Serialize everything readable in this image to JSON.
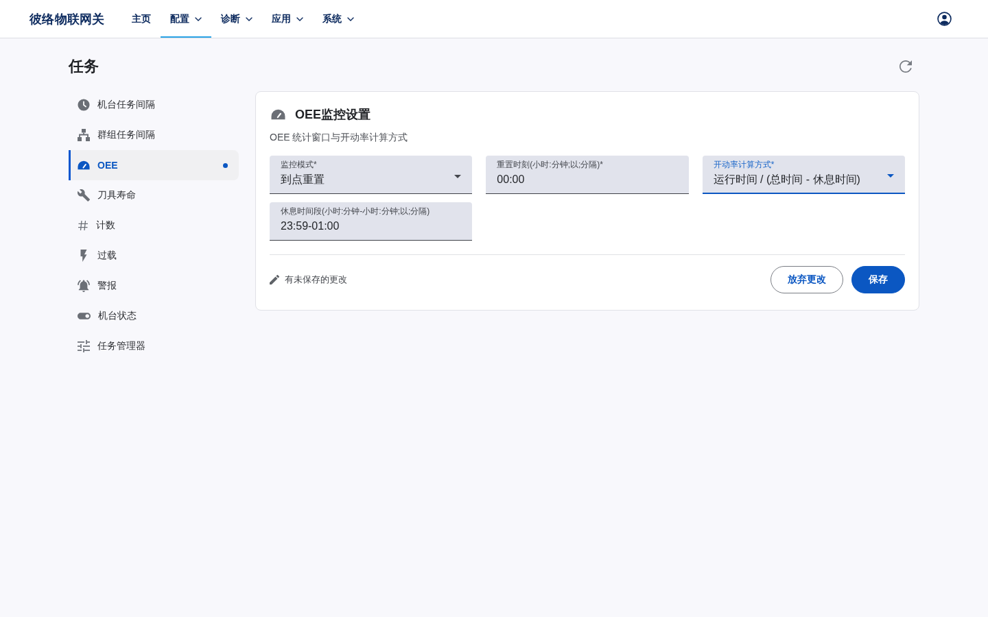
{
  "app_bar": {
    "brand": "彼络物联网关",
    "nav": [
      {
        "label": "主页",
        "selected": false,
        "has_menu": false
      },
      {
        "label": "配置",
        "selected": true,
        "has_menu": true
      },
      {
        "label": "诊断",
        "selected": false,
        "has_menu": true
      },
      {
        "label": "应用",
        "selected": false,
        "has_menu": true
      },
      {
        "label": "系统",
        "selected": false,
        "has_menu": true
      }
    ]
  },
  "page_title": "任务",
  "sidebar": {
    "items": [
      {
        "label": "机台任务间隔",
        "selected": false,
        "unsaved": false
      },
      {
        "label": "群组任务间隔",
        "selected": false,
        "unsaved": false
      },
      {
        "label": "OEE",
        "selected": true,
        "unsaved": true
      },
      {
        "label": "刀具寿命",
        "selected": false,
        "unsaved": false
      },
      {
        "label": "计数",
        "selected": false,
        "unsaved": false
      },
      {
        "label": "过载",
        "selected": false,
        "unsaved": false
      },
      {
        "label": "警报",
        "selected": false,
        "unsaved": false
      },
      {
        "label": "机台状态",
        "selected": false,
        "unsaved": false
      },
      {
        "label": "任务管理器",
        "selected": false,
        "unsaved": false
      }
    ]
  },
  "card": {
    "title": "OEE监控设置",
    "subtitle": "OEE 统计窗口与开动率计算方式",
    "fields": [
      {
        "kind": "select",
        "label": "监控模式*",
        "value": "到点重置",
        "focused": false
      },
      {
        "kind": "text",
        "label": "重置时刻(小时:分钟;以;分隔)*",
        "value": "00:00",
        "focused": false
      },
      {
        "kind": "select",
        "label": "开动率计算方式*",
        "value": "运行时间 / (总时间 - 休息时间)",
        "focused": true
      },
      {
        "kind": "text",
        "label": "休息时间段(小时:分钟-小时:分钟;以;分隔)",
        "value": "23:59-01:00",
        "focused": false
      }
    ],
    "status": "有未保存的更改",
    "buttons": [
      {
        "label": "放弃更改",
        "kind": "outlined"
      },
      {
        "label": "保存",
        "kind": "filled"
      }
    ]
  }
}
